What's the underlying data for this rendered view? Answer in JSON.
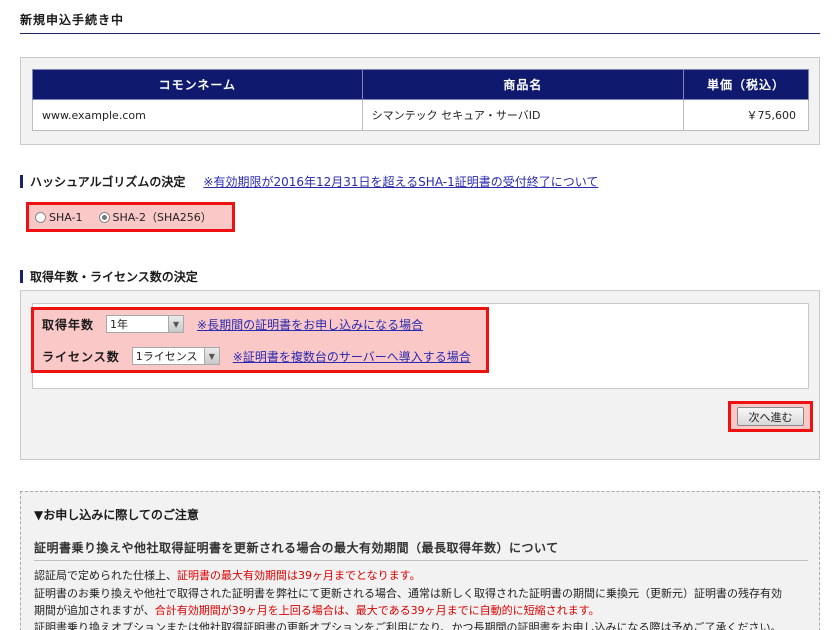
{
  "page_title": "新規申込手続き中",
  "product_table": {
    "headers": [
      "コモンネーム",
      "商品名",
      "単価（税込）"
    ],
    "row": {
      "common_name": "www.example.com",
      "product_name": "シマンテック セキュア・サーバID",
      "price": "￥75,600"
    }
  },
  "hash_section": {
    "heading": "ハッシュアルゴリズムの決定",
    "link": "※有効期限が2016年12月31日を超えるSHA-1証明書の受付終了について",
    "options": [
      {
        "label": "SHA-1",
        "selected": false
      },
      {
        "label": "SHA-2（SHA256）",
        "selected": true
      }
    ]
  },
  "license_section": {
    "heading": "取得年数・ライセンス数の決定",
    "years": {
      "label": "取得年数",
      "value": "1年",
      "link": "※長期間の証明書をお申し込みになる場合"
    },
    "licenses": {
      "label": "ライセンス数",
      "value": "1ライセンス",
      "link": "※証明書を複数台のサーバーへ導入する場合"
    },
    "next_button": "次へ進む"
  },
  "notice": {
    "title": "▼お申し込みに際してのご注意",
    "subtitle": "証明書乗り換えや他社取得証明書を更新される場合の最大有効期間（最長取得年数）について",
    "line1_a": "認証局で定められた仕様上、",
    "line1_b": "証明書の最大有効期間は39ヶ月までとなります。",
    "line2": "証明書のお乗り換えや他社で取得された証明書を弊社にて更新される場合、通常は新しく取得された証明書の期間に乗換元（更新元）証明書の残存有効",
    "line3_a": "期間が追加されますが、",
    "line3_b": "合計有効期間が39ヶ月を上回る場合は、最大である39ヶ月までに自動的に短縮されます。",
    "line4": "証明書乗り換えオプションまたは他社取得証明書の更新オプションをご利用になり、かつ長期間の証明書をお申し込みになる際は予めご了承ください。"
  }
}
